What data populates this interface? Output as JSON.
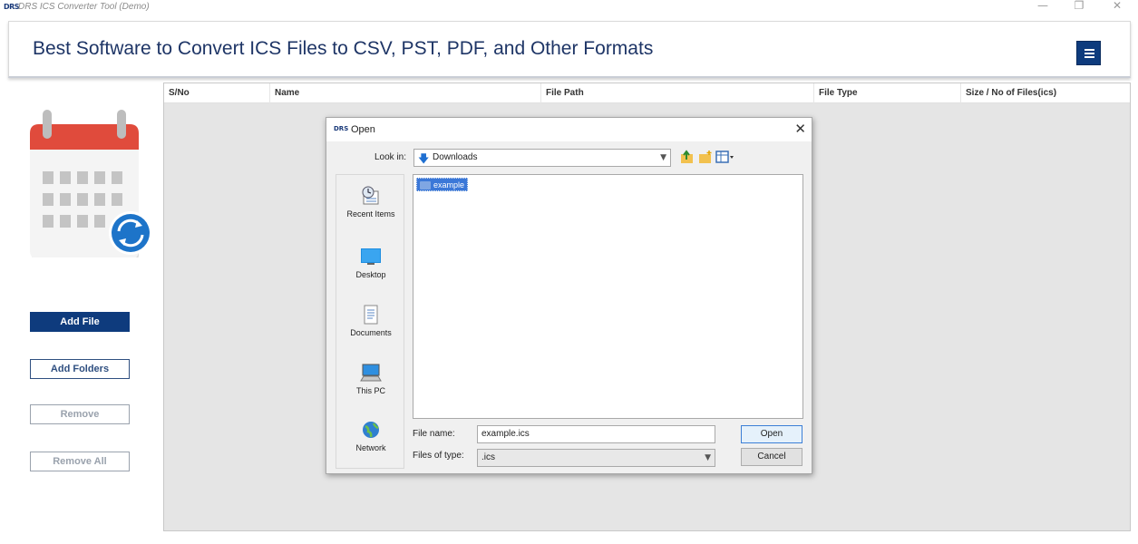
{
  "window": {
    "icon_text": "DRS",
    "title": "DRS ICS Converter Tool (Demo)",
    "minimize_glyph": "—",
    "maximize_glyph": "❐",
    "close_glyph": "✕"
  },
  "header": {
    "title": "Best Software to Convert ICS Files to CSV, PST, PDF, and Other Formats",
    "menu_icon": "hamburger-icon"
  },
  "sidebar": {
    "logo_icon": "calendar-sync-icon",
    "buttons": {
      "add_file": "Add File",
      "add_folders": "Add Folders",
      "remove": "Remove",
      "remove_all": "Remove All"
    }
  },
  "table": {
    "columns": [
      "S/No",
      "Name",
      "File Path",
      "File Type",
      "Size / No of Files(ics)"
    ]
  },
  "dialog": {
    "icon_text": "DRS",
    "title": "Open",
    "close_glyph": "✕",
    "look_in_label": "Look in:",
    "look_in_value": "Downloads",
    "places": [
      "Recent Items",
      "Desktop",
      "Documents",
      "This PC",
      "Network"
    ],
    "files": [
      {
        "name": "example",
        "type": "folder",
        "selected": true
      }
    ],
    "file_name_label": "File name:",
    "file_name_value": "example.ics",
    "files_of_type_label": "Files of type:",
    "files_of_type_value": ".ics",
    "open_button": "Open",
    "cancel_button": "Cancel"
  },
  "colors": {
    "brand": "#0e3b7d",
    "heading": "#1e3566",
    "selection": "#3b78d8"
  }
}
